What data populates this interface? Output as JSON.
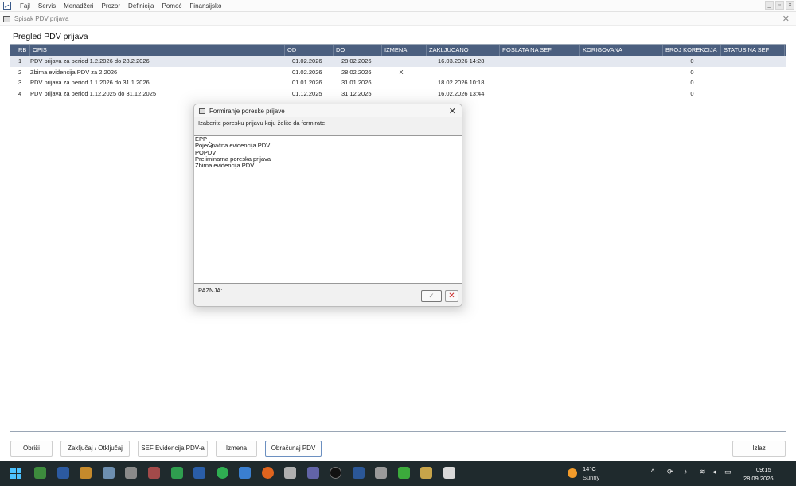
{
  "menu": {
    "items": [
      "Fajl",
      "Servis",
      "Menadžeri",
      "Prozor",
      "Definicija",
      "Pomoć",
      "Finansijsko"
    ],
    "controls": [
      "_",
      "▫",
      "×"
    ]
  },
  "window": {
    "title": "Spisak PDV prijava",
    "page_title": "Pregled PDV prijava"
  },
  "table": {
    "headers": [
      "RB",
      "OPIS",
      "OD",
      "DO",
      "IZMENA",
      "ZAKLJUCANO",
      "POSLATA NA SEF",
      "KORIGOVANA",
      "BROJ KOREKCIJA",
      "STATUS NA SEF"
    ],
    "rows": [
      {
        "rb": "1",
        "opis": "PDV prijava za period 1.2.2026 do 28.2.2026",
        "od": "01.02.2026",
        "do": "28.02.2026",
        "izmena": "",
        "zakljucano": "16.03.2026 14:28",
        "poslata": "",
        "korigovana": "",
        "broj": "0",
        "status": ""
      },
      {
        "rb": "2",
        "opis": "Zbirna evidencija PDV za 2 2026",
        "od": "01.02.2026",
        "do": "28.02.2026",
        "izmena": "X",
        "zakljucano": "",
        "poslata": "",
        "korigovana": "",
        "broj": "0",
        "status": ""
      },
      {
        "rb": "3",
        "opis": "PDV prijava za period 1.1.2026 do 31.1.2026",
        "od": "01.01.2026",
        "do": "31.01.2026",
        "izmena": "",
        "zakljucano": "18.02.2026 10:18",
        "poslata": "",
        "korigovana": "",
        "broj": "0",
        "status": ""
      },
      {
        "rb": "4",
        "opis": "PDV prijava za period 1.12.2025 do 31.12.2025",
        "od": "01.12.2025",
        "do": "31.12.2025",
        "izmena": "",
        "zakljucano": "16.02.2026 13:44",
        "poslata": "",
        "korigovana": "",
        "broj": "0",
        "status": ""
      }
    ]
  },
  "buttons": {
    "obrisi": "Obriši",
    "zakljucaj": "Zaključaj / Otključaj",
    "sef": "SEF Evidencija PDV-a",
    "izmena": "Izmena",
    "obracunaj": "Obračunaj PDV",
    "izlaz": "Izlaz"
  },
  "dialog": {
    "title": "Formiranje poreske prijave",
    "subtitle": "Izaberite poresku prijavu koju želite da formirate",
    "options": [
      "EPP",
      "Pojedinačna evidencija PDV",
      "POPDV",
      "Preliminarna poreska prijava",
      "Zbirna evidencija PDV"
    ],
    "note": "PAZNJA:",
    "ok_symbol": "✓",
    "cancel_symbol": "✕",
    "close_symbol": "✕"
  },
  "taskbar": {
    "temperature": "14°C",
    "condition": "Sunny",
    "time": "09:15",
    "date": "28.09.2026"
  },
  "colors": {
    "header_bg": "#4b5f7f",
    "selected_row": "#e4e8f0",
    "taskbar": "#1f2a2d",
    "cancel_red": "#cc2a2a"
  }
}
